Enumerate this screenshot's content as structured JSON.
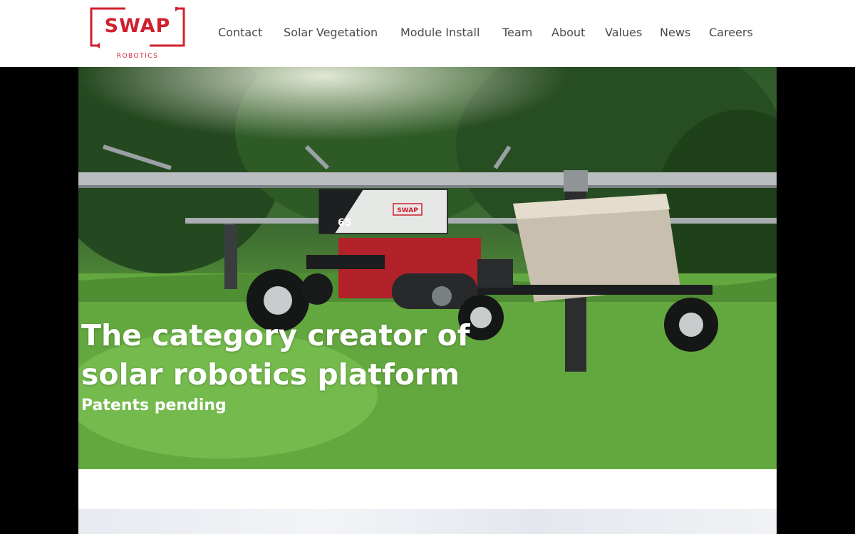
{
  "brand": {
    "name": "SWAP",
    "tagline": "ROBOTICS",
    "color": "#d11f2e"
  },
  "nav": {
    "items": [
      {
        "label": "Contact"
      },
      {
        "label": "Solar Vegetation"
      },
      {
        "label": "Module Install"
      },
      {
        "label": "Team"
      },
      {
        "label": "About"
      },
      {
        "label": "Values"
      },
      {
        "label": "News"
      },
      {
        "label": "Careers"
      }
    ]
  },
  "hero": {
    "headline": "The category creator of solar robotics platform",
    "subline": "Patents pending",
    "image_subject": "robot-with-solar-panels-photo",
    "robot_badge_number": "65",
    "robot_badge_logo": "SWAP"
  },
  "colors": {
    "nav_text": "#4a4a4a",
    "page_background": "#000000",
    "hero_text": "#ffffff"
  }
}
